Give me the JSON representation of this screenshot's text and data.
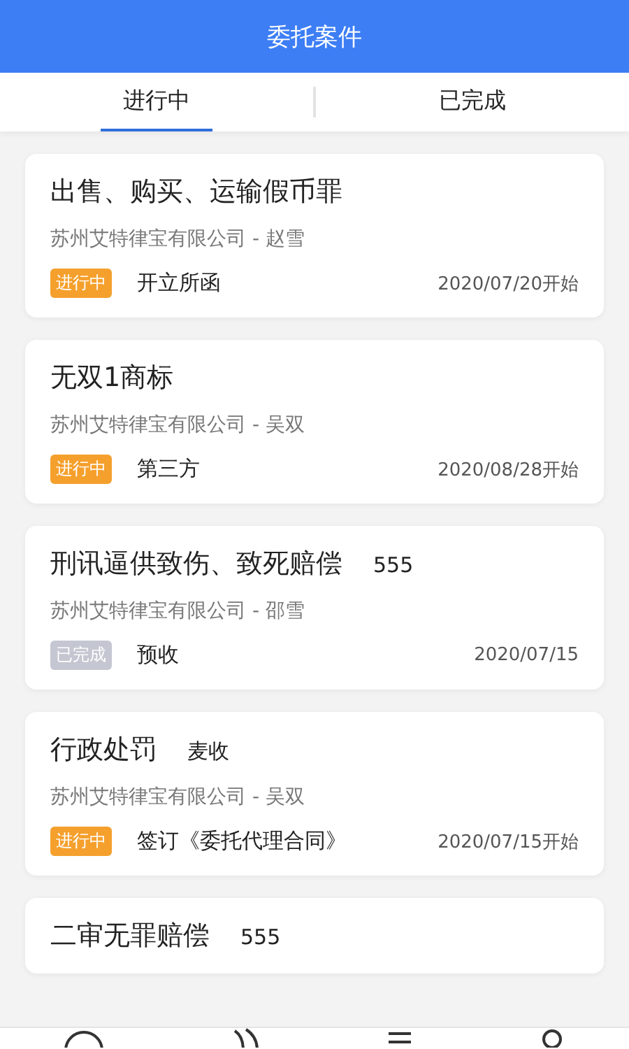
{
  "header": {
    "title": "委托案件"
  },
  "tabs": [
    {
      "label": "进行中",
      "selected": true
    },
    {
      "label": "已完成",
      "selected": false
    }
  ],
  "cases": [
    {
      "title": "出售、购买、运输假币罪",
      "company": "苏州艾特律宝有限公司 - 赵雪",
      "status": {
        "kind": "ongoing",
        "label": "进行中"
      },
      "stage": "开立所函",
      "date": "2020/07/20开始"
    },
    {
      "title": "无双1商标",
      "company": "苏州艾特律宝有限公司 - 吴双",
      "status": {
        "kind": "ongoing",
        "label": "进行中"
      },
      "stage": "第三方",
      "date": "2020/08/28开始"
    },
    {
      "title": "刑讯逼供致伤、致死赔偿",
      "note": "555",
      "company": "苏州艾特律宝有限公司 - 邵雪",
      "status": {
        "kind": "done",
        "label": "已完成"
      },
      "stage": "预收",
      "date": "2020/07/15"
    },
    {
      "title": "行政处罚",
      "note": "麦收",
      "company": "苏州艾特律宝有限公司 - 吴双",
      "status": {
        "kind": "ongoing",
        "label": "进行中"
      },
      "stage": "签订《委托代理合同》",
      "date": "2020/07/15开始"
    },
    {
      "title": "二审无罪赔偿",
      "note": "555"
    }
  ]
}
